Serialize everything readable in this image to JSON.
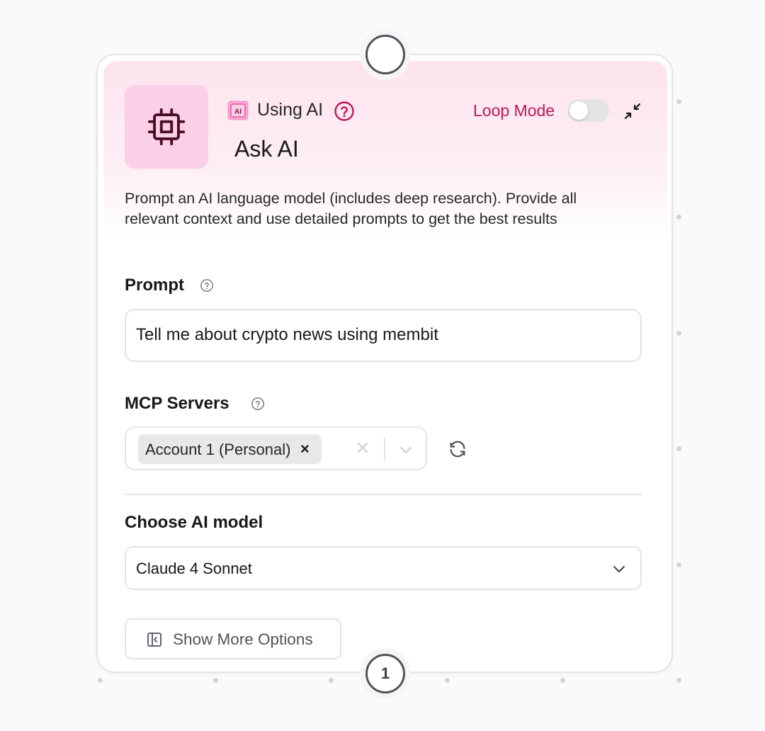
{
  "node": {
    "category_label": "Using AI",
    "badge_text": "AI",
    "title": "Ask AI",
    "loop_mode_label": "Loop Mode",
    "loop_mode_enabled": false,
    "description": "Prompt an AI language model (includes deep research). Provide all relevant context and use detailed prompts to get the best results",
    "output_handle_label": "1"
  },
  "prompt": {
    "label": "Prompt",
    "value": "Tell me about crypto news using membit"
  },
  "mcp_servers": {
    "label": "MCP Servers",
    "selected": [
      "Account 1 (Personal)"
    ],
    "chip_remove": "×"
  },
  "model": {
    "label": "Choose AI model",
    "selected": "Claude 4 Sonnet"
  },
  "more_options": {
    "label": "Show More Options"
  },
  "icons": {
    "node": "cpu-chip-icon",
    "help": "help-circle-icon",
    "collapse": "collapse-arrows-icon",
    "refresh": "refresh-icon",
    "chevron": "chevron-down-icon",
    "panel": "panel-left-icon"
  },
  "colors": {
    "accent": "#be185d",
    "icon_bg": "#fbcfe6",
    "header_tint": "#fde4ef"
  }
}
